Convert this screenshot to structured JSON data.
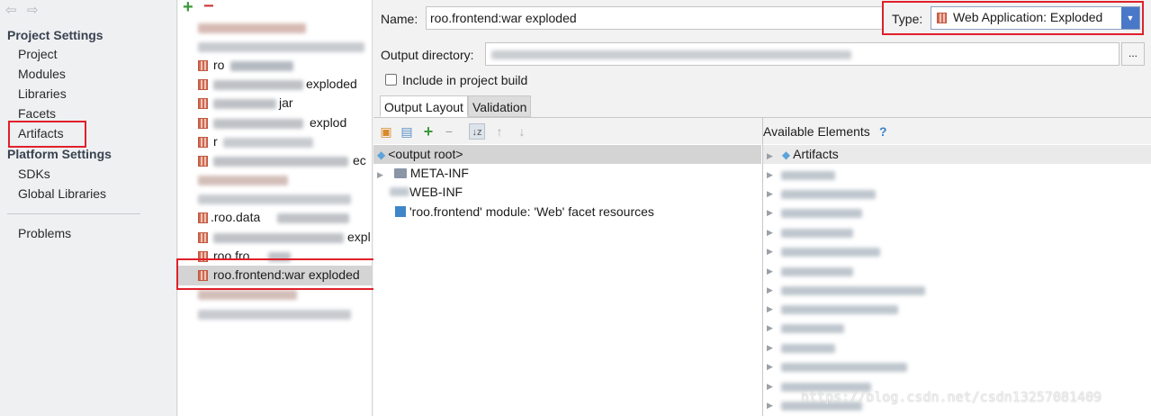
{
  "nav": {
    "project_settings": "Project Settings",
    "project_items": [
      "Project",
      "Modules",
      "Libraries",
      "Facets",
      "Artifacts"
    ],
    "platform_settings": "Platform Settings",
    "platform_items": [
      "SDKs",
      "Global Libraries"
    ],
    "problems": "Problems",
    "selected": "Artifacts"
  },
  "artifacts_list": {
    "toolbar": {
      "add": "+",
      "remove": "−"
    },
    "partial_labels": {
      "r3": "ro",
      "r4": "exploded",
      "r5": "jar",
      "r6": "explod",
      "r7": "r",
      "r8": "ec",
      "r10": ".roo.data",
      "r11": "expl",
      "r12": "roo.fro"
    },
    "selected_item": "roo.frontend:war exploded"
  },
  "form": {
    "name_label": "Name:",
    "name_value": "roo.frontend:war exploded",
    "type_label": "Type:",
    "type_value": "Web Application: Exploded",
    "output_dir_label": "Output directory:",
    "ellipsis": "...",
    "include_label": "Include in project build",
    "include_checked": false
  },
  "tabs": [
    "Output Layout",
    "Validation"
  ],
  "output_layout": {
    "root": "<output root>",
    "children": [
      "META-INF",
      "WEB-INF",
      "'roo.frontend' module: 'Web' facet resources"
    ]
  },
  "available": {
    "title": "Available Elements",
    "help": "?",
    "first": "Artifacts"
  },
  "watermark": "https://blog.csdn.net/csdn13257081409",
  "colors": {
    "highlight_border": "#e0202a",
    "selection": "#d4d4d4",
    "accent": "#4a78c8"
  }
}
